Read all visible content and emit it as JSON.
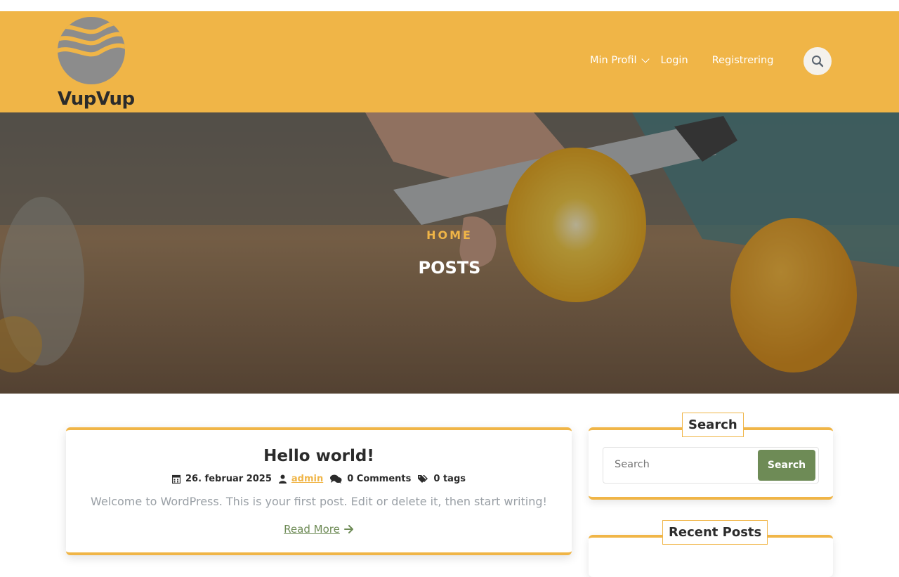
{
  "brand": {
    "name": "VupVup",
    "accent": "#f0b547",
    "green": "#6e8b56"
  },
  "nav": {
    "items": [
      {
        "label": "Min Profil",
        "has_dropdown": true
      },
      {
        "label": "Login"
      },
      {
        "label": "Registrering"
      }
    ],
    "search_icon": "search-icon"
  },
  "hero": {
    "breadcrumb": "HOME",
    "title": "POSTS"
  },
  "post": {
    "title": "Hello world!",
    "date": "26. februar 2025",
    "author": "admin",
    "comments": "0 Comments",
    "tags": "0 tags",
    "excerpt": "Welcome to WordPress. This is your first post. Edit or delete it, then start writing!",
    "read_more": "Read More"
  },
  "sidebar": {
    "search_widget": {
      "title": "Search",
      "placeholder": "Search",
      "button": "Search"
    },
    "recent_widget": {
      "title": "Recent Posts"
    }
  }
}
